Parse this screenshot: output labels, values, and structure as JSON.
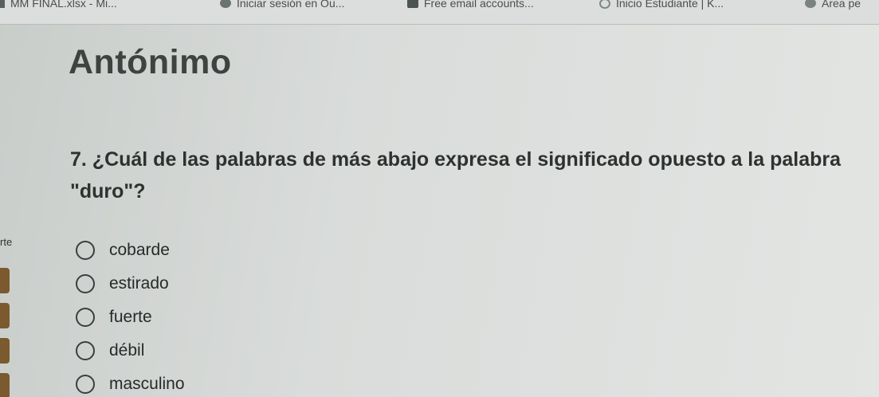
{
  "bookmarks": [
    {
      "label": "MM FINAL.xlsx - Mi...",
      "icon": "spreadsheet-icon"
    },
    {
      "label": "Iniciar sesión en Ou...",
      "icon": "outlook-icon"
    },
    {
      "label": "Free email accounts...",
      "icon": "mail-icon"
    },
    {
      "label": "Inicio Estudiante | K...",
      "icon": "k-logo-icon"
    },
    {
      "label": "Área pe",
      "icon": "circle-icon"
    }
  ],
  "sidebar": {
    "partial_label": "rte"
  },
  "quiz": {
    "section_title": "Antónimo",
    "question": "7. ¿Cuál de las palabras de más abajo expresa el significado opuesto a la palabra \"duro\"?",
    "options": [
      {
        "label": "cobarde"
      },
      {
        "label": "estirado"
      },
      {
        "label": "fuerte"
      },
      {
        "label": "débil"
      },
      {
        "label": "masculino"
      }
    ]
  }
}
